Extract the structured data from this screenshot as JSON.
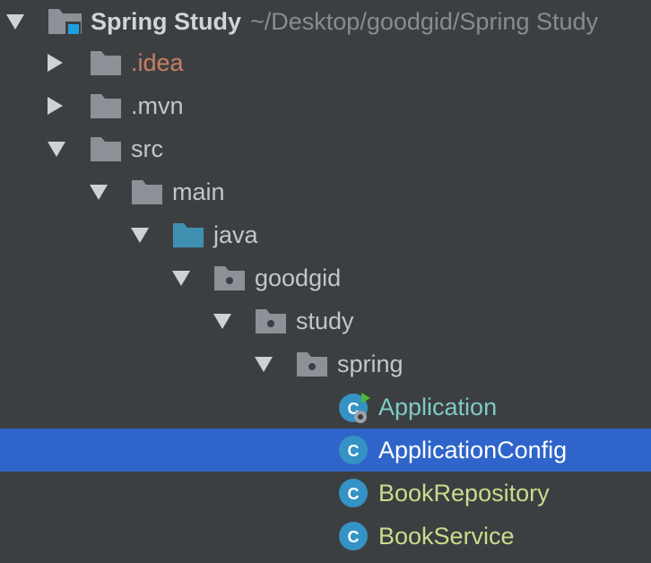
{
  "project": {
    "name": "Spring Study",
    "path": "~/Desktop/goodgid/Spring Study"
  },
  "folders": {
    "idea": ".idea",
    "mvn": ".mvn",
    "src": "src",
    "main": "main",
    "java": "java",
    "goodgid": "goodgid",
    "study": "study",
    "spring": "spring"
  },
  "files": {
    "application": "Application",
    "application_config": "ApplicationConfig",
    "book_repository": "BookRepository",
    "book_service": "BookService"
  },
  "colors": {
    "background": "#3c3f41",
    "selection": "#2f65ca",
    "folder": "#8b9196",
    "source_folder": "#3f8fb0",
    "class_icon": "#3592c4",
    "excluded_text": "#c77e63",
    "spring_class_text": "#c9dc8c",
    "run_class_text": "#7fcbc3"
  },
  "icons": {
    "expanded": "triangle-down-icon",
    "collapsed": "triangle-right-icon",
    "folder": "folder-icon",
    "package": "package-icon",
    "class": "class-icon",
    "module": "module-icon"
  }
}
